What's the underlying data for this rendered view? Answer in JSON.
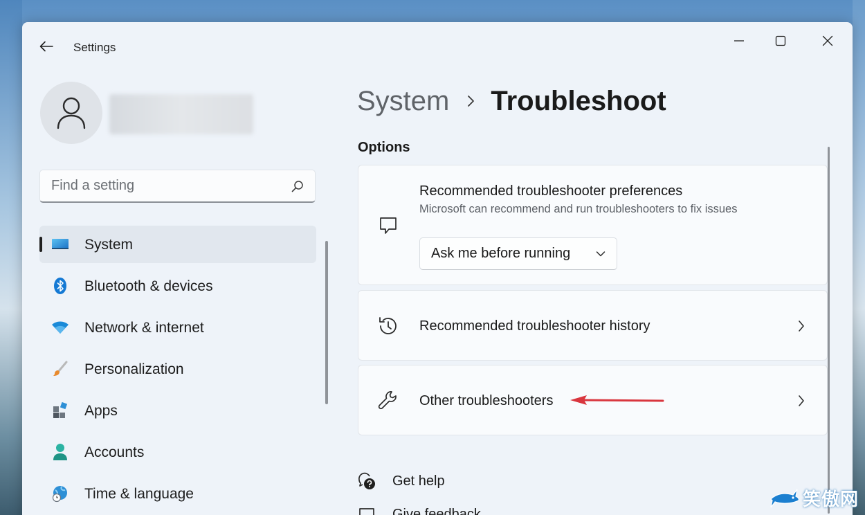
{
  "window": {
    "title": "Settings",
    "controls": {
      "minimize": "minimize-icon",
      "maximize": "maximize-icon",
      "close": "close-icon"
    }
  },
  "sidebar": {
    "search": {
      "placeholder": "Find a setting",
      "value": ""
    },
    "items": [
      {
        "label": "System",
        "icon": "display-icon",
        "active": true
      },
      {
        "label": "Bluetooth & devices",
        "icon": "bluetooth-icon",
        "active": false
      },
      {
        "label": "Network & internet",
        "icon": "wifi-icon",
        "active": false
      },
      {
        "label": "Personalization",
        "icon": "brush-icon",
        "active": false
      },
      {
        "label": "Apps",
        "icon": "apps-icon",
        "active": false
      },
      {
        "label": "Accounts",
        "icon": "person-icon",
        "active": false
      },
      {
        "label": "Time & language",
        "icon": "globe-clock-icon",
        "active": false
      }
    ]
  },
  "main": {
    "breadcrumb": {
      "parent": "System",
      "current": "Troubleshoot"
    },
    "section_title": "Options",
    "cards": {
      "preferences": {
        "title": "Recommended troubleshooter preferences",
        "description": "Microsoft can recommend and run troubleshooters to fix issues",
        "dropdown_value": "Ask me before running"
      },
      "history": {
        "title": "Recommended troubleshooter history"
      },
      "other": {
        "title": "Other troubleshooters"
      }
    },
    "links": {
      "get_help": "Get help",
      "give_feedback": "Give feedback"
    }
  },
  "watermark": {
    "text": "笑傲网"
  },
  "colors": {
    "accent": "#0078d4",
    "annotation_arrow": "#d9363e",
    "window_bg": "#eef3f9",
    "card_bg": "#f9fbfd"
  }
}
